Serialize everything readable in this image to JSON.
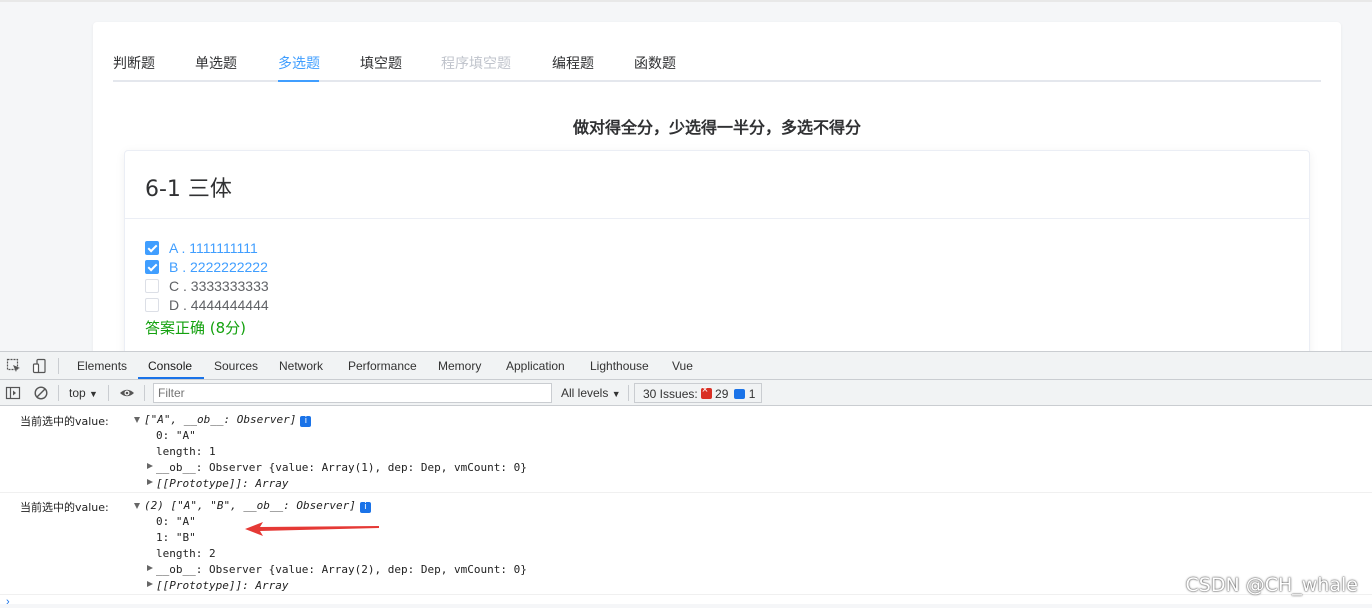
{
  "app": {
    "tabs": [
      "判断题",
      "单选题",
      "多选题",
      "填空题",
      "程序填空题",
      "编程题",
      "函数题"
    ],
    "active_tab": "多选题",
    "disabled_tab": "程序填空题",
    "hint": "做对得全分，少选得一半分，多选不得分",
    "question": {
      "title": "6-1 三体",
      "options": [
        {
          "label": "A . 1111111111",
          "checked": true
        },
        {
          "label": "B . 2222222222",
          "checked": true
        },
        {
          "label": "C . 3333333333",
          "checked": false
        },
        {
          "label": "D . 4444444444",
          "checked": false
        }
      ],
      "result": "答案正确 (8分)"
    }
  },
  "devtools": {
    "tabs": [
      "Elements",
      "Console",
      "Sources",
      "Network",
      "Performance",
      "Memory",
      "Application",
      "Lighthouse",
      "Vue"
    ],
    "active_tab": "Console",
    "context": "top",
    "filter_placeholder": "Filter",
    "levels": "All levels",
    "issues_label": "30 Issues:",
    "errors_count": "29",
    "info_count": "1"
  },
  "logs": [
    {
      "prefix": "当前选中的value:",
      "summary": "[\"A\", __ob__: Observer]",
      "items": [
        "0: \"A\"",
        "length: 1",
        "__ob__: Observer {value: Array(1), dep: Dep, vmCount: 0}",
        "[[Prototype]]: Array"
      ]
    },
    {
      "prefix": "当前选中的value:",
      "summary": "(2) [\"A\", \"B\", __ob__: Observer]",
      "items": [
        "0: \"A\"",
        "1: \"B\"",
        "length: 2",
        "__ob__: Observer {value: Array(2), dep: Dep, vmCount: 0}",
        "[[Prototype]]: Array"
      ]
    }
  ],
  "watermark": "CSDN @CH_whale",
  "colors": {
    "accent": "#409eff",
    "success": "#13a10e",
    "devtools_blue": "#1a73e8",
    "arrow": "#e53935"
  }
}
